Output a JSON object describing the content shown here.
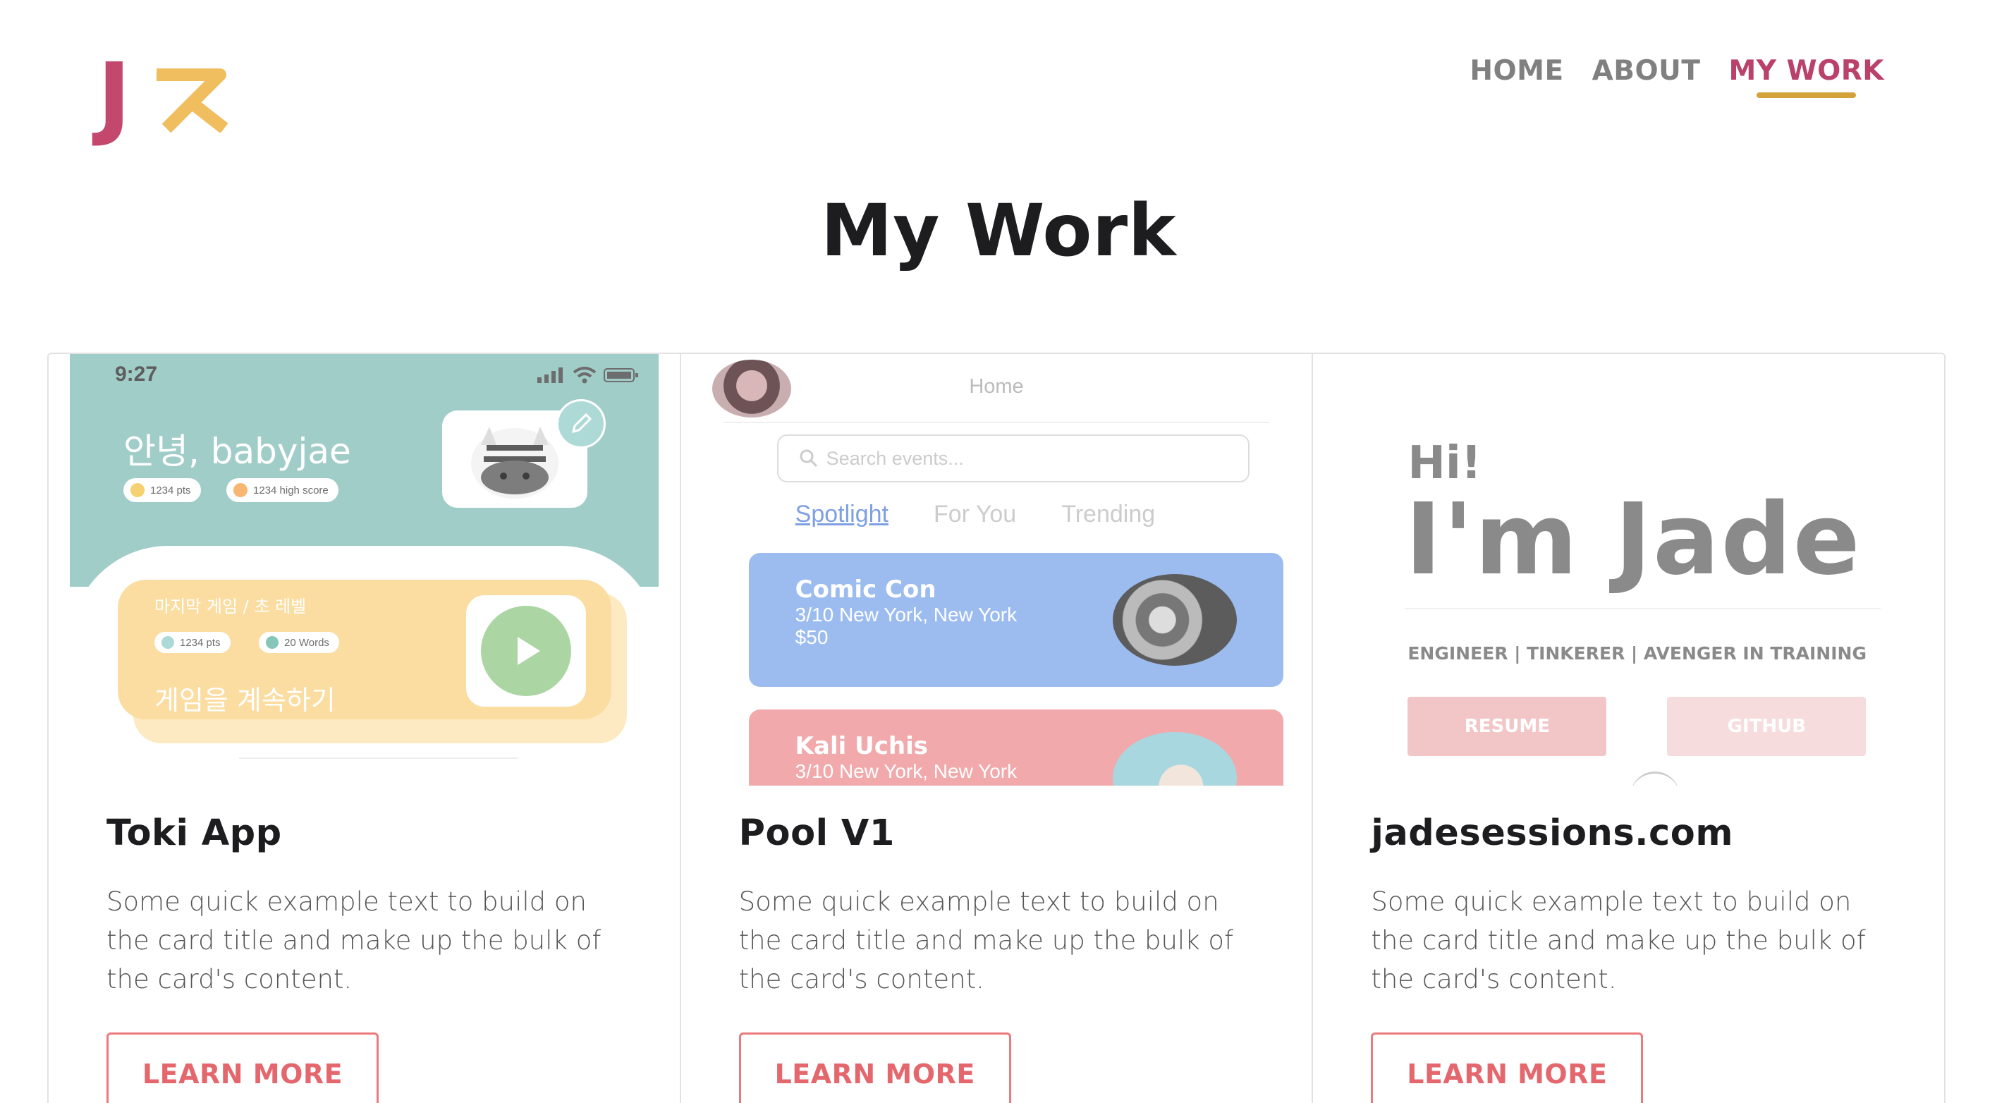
{
  "header": {
    "logo_letter": "J",
    "logo_korean": "ㅈ",
    "nav": [
      {
        "label": "HOME",
        "active": false
      },
      {
        "label": "ABOUT",
        "active": false
      },
      {
        "label": "MY WORK",
        "active": true
      }
    ]
  },
  "page_title": "My Work",
  "colors": {
    "logo_pink": "#c4486e",
    "logo_gold": "#f0be5e",
    "nav_active": "#b9416a",
    "nav_underline": "#d4a23a",
    "button_accent": "#e5676e"
  },
  "cards": [
    {
      "title": "Toki App",
      "text": "Some quick example text to build on the card title and make up the bulk of the card's content.",
      "button": "LEARN MORE",
      "thumb": {
        "time": "9:27",
        "greeting": "안녕, babyjae",
        "pill_pts": "1234 pts",
        "pill_high": "1234 high score",
        "game_title": "마지막 게임 / 초 레벨",
        "game_pts": "1234 pts",
        "game_words": "20 Words",
        "game_cta": "게임을 계속하기"
      }
    },
    {
      "title": "Pool V1",
      "text": "Some quick example text to build on the card title and make up the bulk of the card's content.",
      "button": "LEARN MORE",
      "thumb": {
        "home": "Home",
        "search_placeholder": "Search events...",
        "tabs": [
          "Spotlight",
          "For You",
          "Trending"
        ],
        "events": [
          {
            "name": "Comic Con",
            "date_place": "3/10 New York, New York",
            "price": "$50"
          },
          {
            "name": "Kali Uchis",
            "date_place": "3/10 New York, New York",
            "price": ""
          }
        ]
      }
    },
    {
      "title": "jadesessions.com",
      "text": "Some quick example text to build on the card title and make up the bulk of the card's content.",
      "button": "LEARN MORE",
      "thumb": {
        "hi": "Hi!",
        "name": "I'm Jade",
        "tagline": "ENGINEER | TINKERER | AVENGER IN TRAINING",
        "btn_resume": "RESUME",
        "btn_github": "GITHUB"
      }
    }
  ]
}
